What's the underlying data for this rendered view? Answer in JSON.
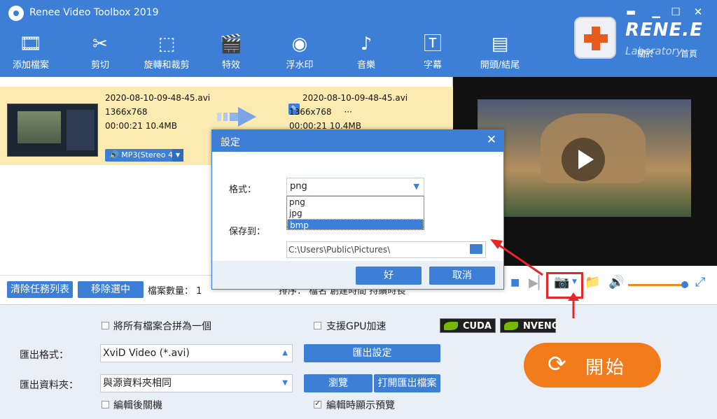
{
  "window": {
    "title": "Renee Video Toolbox 2019",
    "min": "▁",
    "restore": "☐",
    "close": "✕",
    "menu": "▬"
  },
  "toolbar": {
    "items": [
      {
        "label": "添加檔案",
        "icon": "add-file-icon",
        "glyph": "🎞"
      },
      {
        "label": "剪切",
        "icon": "scissors-icon",
        "glyph": "✂"
      },
      {
        "label": "旋轉和裁剪",
        "icon": "crop-rotate-icon",
        "glyph": "⬚"
      },
      {
        "label": "特效",
        "icon": "effects-icon",
        "glyph": "🎬"
      },
      {
        "label": "浮水印",
        "icon": "watermark-icon",
        "glyph": "◉"
      },
      {
        "label": "音樂",
        "icon": "music-icon",
        "glyph": "♪"
      },
      {
        "label": "字幕",
        "icon": "subtitle-icon",
        "glyph": "🅃"
      },
      {
        "label": "開頭/結尾",
        "icon": "intro-outro-icon",
        "glyph": "▤"
      }
    ]
  },
  "brand": {
    "name": "RENE.E",
    "sub": "Laboratory",
    "about": "關於",
    "home": "首頁"
  },
  "task": {
    "source": {
      "filename": "2020-08-10-09-48-45.avi",
      "resolution": "1366x768",
      "duration_size": "00:00:21  10.4MB"
    },
    "audio": "MP3(Stereo 4",
    "output": {
      "filename": "2020-08-10-09-48-45.avi",
      "resolution": "1366x768",
      "extra": "···",
      "duration_size": "00:00:21  10.4MB"
    }
  },
  "list_bottom": {
    "clear_label": "清除任務列表",
    "remove_label": "移除選中",
    "file_count": "檔案數量：  1",
    "sort_text": "排序：   檔名     創建時間     持續時長"
  },
  "dialog": {
    "title": "設定",
    "close": "✕",
    "format_label": "格式：",
    "format_value": "png",
    "format_options": [
      "png",
      "jpg",
      "bmp"
    ],
    "selected_option": "bmp",
    "save_label": "保存到：",
    "save_path": "C:\\Users\\Public\\Pictures\\",
    "ok": "好",
    "cancel": "取消"
  },
  "settings": {
    "merge_label": "將所有檔案合拼為一個",
    "gpu_label": "支援GPU加速",
    "cuda": "CUDA",
    "nvenc": "NVENC",
    "export_format_label": "匯出格式：",
    "export_format_value": "XviD Video (*.avi)",
    "export_settings_label": "匯出設定",
    "export_folder_label": "匯出資料夾：",
    "export_folder_value": "與源資料夾相同",
    "browse_label": "瀏覽",
    "open_folder_label": "打開匯出檔案",
    "shutdown_label": "編輯後關機",
    "preview_label": "編輯時顯示預覽",
    "start_label": "開始"
  },
  "colors": {
    "accent": "#3d7fd6",
    "start": "#f27c1b",
    "highlight": "#e8262a",
    "task_row": "#fcebb0"
  }
}
